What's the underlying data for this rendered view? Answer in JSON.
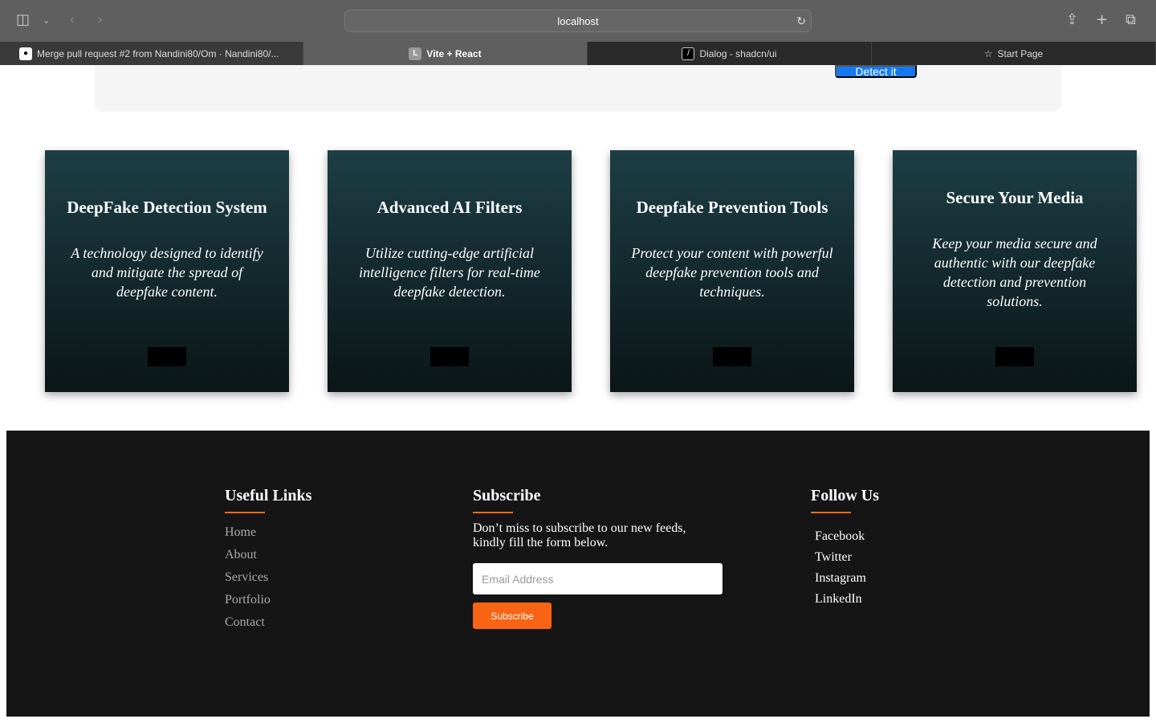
{
  "browser": {
    "url": "localhost",
    "tabs": [
      {
        "label": "Merge pull request #2 from Nandini80/Om · Nandini80/...",
        "icon": "github-icon"
      },
      {
        "label": "Vite + React",
        "icon": "L"
      },
      {
        "label": "Dialog - shadcn/ui",
        "icon": "shadcn-icon"
      },
      {
        "label": "Start Page",
        "icon": "star-icon"
      }
    ]
  },
  "hero": {
    "detect_label": "Detect it"
  },
  "cards": [
    {
      "title": "DeepFake Detection System",
      "text": "A technology designed to identify and mitigate the spread of deepfake content."
    },
    {
      "title": "Advanced AI Filters",
      "text": "Utilize cutting-edge artificial intelligence filters for real-time deepfake detection."
    },
    {
      "title": "Deepfake Prevention Tools",
      "text": "Protect your content with powerful deepfake prevention tools and techniques."
    },
    {
      "title": "Secure Your Media",
      "text": "Keep your media secure and authentic with our deepfake detection and prevention solutions."
    }
  ],
  "footer": {
    "useful": {
      "title": "Useful Links",
      "links": [
        "Home",
        "About",
        "Services",
        "Portfolio",
        "Contact"
      ]
    },
    "subscribe": {
      "title": "Subscribe",
      "text": "Don’t miss to subscribe to our new feeds, kindly fill the form below.",
      "placeholder": "Email Address",
      "button": "Subscribe"
    },
    "follow": {
      "title": "Follow Us",
      "links": [
        "Facebook",
        "Twitter",
        "Instagram",
        "LinkedIn"
      ]
    },
    "accent": "#f26a1b"
  }
}
